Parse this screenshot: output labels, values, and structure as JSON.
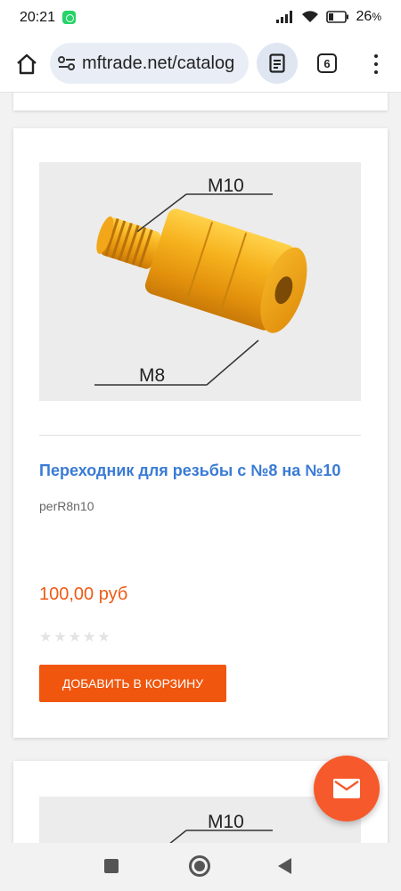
{
  "status": {
    "time": "20:21",
    "battery": "26",
    "battery_unit": "%"
  },
  "browser": {
    "url": "mftrade.net/catalog",
    "tab_count": "6"
  },
  "product": {
    "image_labels": [
      "M10",
      "M8"
    ],
    "title": "Переходник для резьбы с №8 на №10",
    "sku": "perR8n10",
    "price": "100,00 руб",
    "rating": 0,
    "add_to_cart_label": "ДОБАВИТЬ В КОРЗИНУ"
  },
  "next_product": {
    "image_label": "M10"
  },
  "colors": {
    "accent": "#f0560e",
    "title_link": "#3a7bd5",
    "fab": "#f6592b"
  }
}
